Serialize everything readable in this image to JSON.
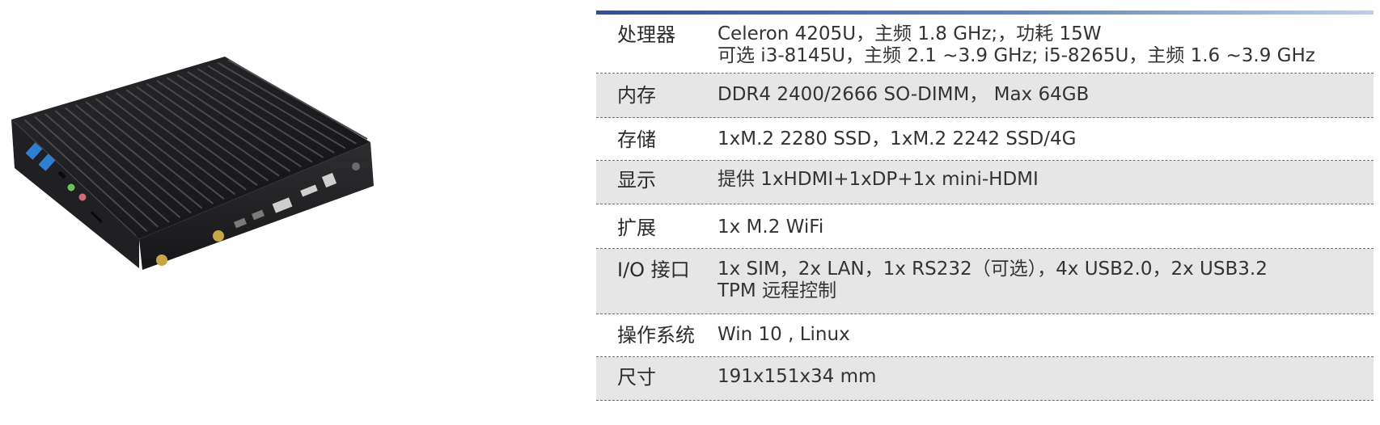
{
  "spec_table": {
    "rows": [
      {
        "label": "处理器",
        "lines": [
          "Celeron 4205U，主频 1.8 GHz;，功耗 15W",
          "可选 i3-8145U，主频 2.1 ~3.9 GHz; i5-8265U，主频 1.6 ~3.9 GHz"
        ]
      },
      {
        "label": "内存",
        "lines": [
          "DDR4 2400/2666 SO-DIMM，  Max 64GB"
        ]
      },
      {
        "label": "存储",
        "lines": [
          "1xM.2  2280 SSD，1xM.2  2242 SSD/4G"
        ]
      },
      {
        "label": "显示",
        "lines": [
          "提供 1xHDMI+1xDP+1x mini-HDMI"
        ]
      },
      {
        "label": "扩展",
        "lines": [
          "1x M.2  WiFi"
        ]
      },
      {
        "label": "I/O 接口",
        "lines": [
          "1x SIM，2x LAN，1x RS232（可选），4x USB2.0，2x USB3.2",
          "TPM 远程控制"
        ]
      },
      {
        "label": "操作系统",
        "lines": [
          "Win 10 , Linux"
        ]
      },
      {
        "label": "尺寸",
        "lines": [
          "191x151x34 mm"
        ]
      }
    ]
  },
  "colors": {
    "accent_rule": "#2f4f9a",
    "row_shade": "#e6e6e6",
    "device_body": "#1c1c1e",
    "usb_blue": "#2f7fd0"
  }
}
